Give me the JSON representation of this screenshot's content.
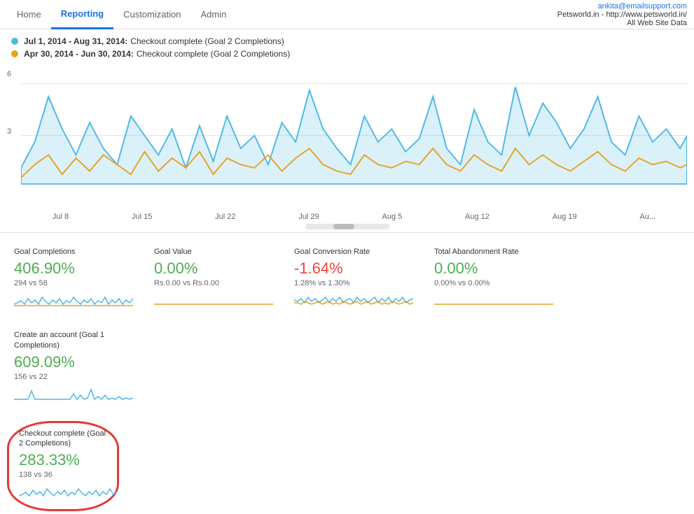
{
  "header": {
    "nav_items": [
      {
        "id": "home",
        "label": "Home",
        "active": false
      },
      {
        "id": "reporting",
        "label": "Reporting",
        "active": true
      },
      {
        "id": "customization",
        "label": "Customization",
        "active": false
      },
      {
        "id": "admin",
        "label": "Admin",
        "active": false
      }
    ],
    "user_email": "ankita@emailsupport.com",
    "site_label": "Petsworld.in - http://www.petsworld.in/",
    "data_label": "All Web Site Data"
  },
  "legend": [
    {
      "id": "blue",
      "color": "#4db8e8",
      "date_range": "Jul 1, 2014 - Aug 31, 2014:",
      "metric": "Checkout complete (Goal 2 Completions)"
    },
    {
      "id": "orange",
      "color": "#e8a020",
      "date_range": "Apr 30, 2014 - Jun 30, 2014:",
      "metric": "Checkout complete (Goal 2 Completions)"
    }
  ],
  "chart": {
    "y_max": "6",
    "y_mid": "3",
    "x_labels": [
      "Jul 8",
      "Jul 15",
      "Jul 22",
      "Jul 29",
      "Aug 5",
      "Aug 12",
      "Aug 19",
      "Au..."
    ]
  },
  "stats": [
    {
      "id": "goal-completions",
      "label": "Goal Completions",
      "value": "406.90%",
      "positive": true,
      "sub": "294 vs 58",
      "chart_type": "wavy-blue"
    },
    {
      "id": "goal-value",
      "label": "Goal Value",
      "value": "0.00%",
      "positive": true,
      "sub": "Rs.0.00 vs Rs.0.00",
      "chart_type": "flat-orange"
    },
    {
      "id": "goal-conversion-rate",
      "label": "Goal Conversion Rate",
      "value": "-1.64%",
      "positive": false,
      "sub": "1.28% vs 1.30%",
      "chart_type": "wavy-blue"
    },
    {
      "id": "total-abandonment-rate",
      "label": "Total Abandonment Rate",
      "value": "0.00%",
      "positive": true,
      "sub": "0.00% vs 0.00%",
      "chart_type": "flat-orange"
    },
    {
      "id": "create-account",
      "label": "Create an account (Goal 1 Completions)",
      "value": "609.09%",
      "positive": true,
      "sub": "156 vs 22",
      "chart_type": "wavy-blue"
    },
    {
      "id": "checkout-complete",
      "label": "Checkout complete (Goal 2 Completions)",
      "value": "283.33%",
      "positive": true,
      "sub": "138 vs 36",
      "chart_type": "wavy-blue",
      "highlighted": true
    }
  ]
}
